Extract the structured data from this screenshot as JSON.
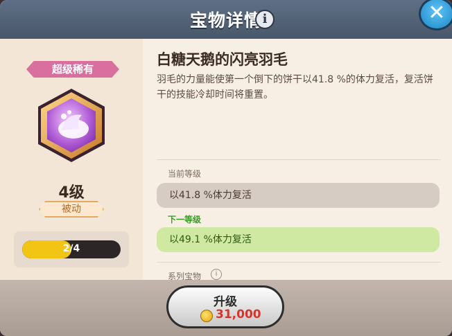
{
  "header": {
    "title": "宝物详情",
    "info_icon": "info-icon",
    "close_icon": "close-icon"
  },
  "colors": {
    "header_bg": "#56657a",
    "close_button": "#2b9be0",
    "rarity": "#d86f9e",
    "progress_fill": "#f2c514",
    "next_level_text": "#3a9b24",
    "next_level_bg": "#cfe9a2",
    "price_text": "#d7342b"
  },
  "treasure": {
    "rarity": "超级稀有",
    "level": "4级",
    "type": "被动",
    "progress_text": "2/4",
    "progress_fraction": 0.5,
    "image_icon": "swan-feather-icon"
  },
  "details": {
    "title": "白糖天鹅的闪亮羽毛",
    "description": "羽毛的力量能使第一个倒下的饼干以41.8 %的体力复活，复活饼干的技能冷却时间将重置。",
    "current_label": "当前等级",
    "current_value": "以41.8 %体力复活",
    "next_label": "下一等级",
    "next_value": "以49.1 %体力复活",
    "series_label": "系列宝物"
  },
  "upgrade": {
    "label": "升级",
    "price": "31,000",
    "coin_icon": "coin-icon"
  }
}
